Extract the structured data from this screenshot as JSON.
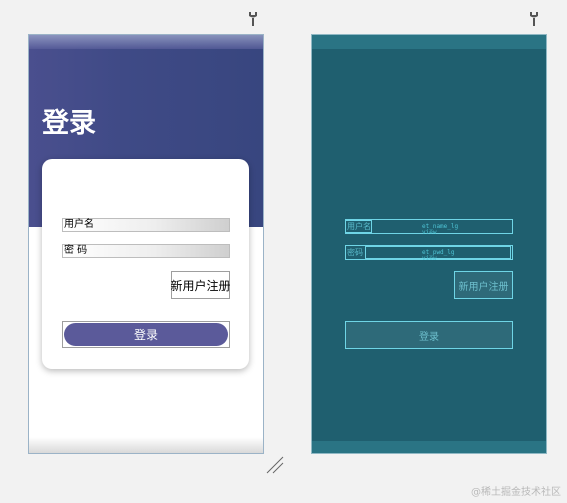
{
  "design": {
    "title": "登录",
    "username_label": "用户名",
    "password_label": "密 码",
    "register_button": "新用户注册",
    "login_button": "登录"
  },
  "blueprint": {
    "username_label": "用户名",
    "username_id": "et_name_lg",
    "username_type": "view",
    "password_label": "密码",
    "password_id": "et_pwd_lg",
    "password_type": "view",
    "register_button": "新用户注册",
    "login_button": "登录"
  },
  "watermark": "@稀土掘金技术社区",
  "colors": {
    "header": "#3f4a86",
    "accent": "#5b5a9a",
    "blueprint_bg": "#1f5f6f",
    "blueprint_line": "#6fd5e6"
  },
  "icons": [
    "wrench-icon",
    "resize-handle-icon"
  ]
}
